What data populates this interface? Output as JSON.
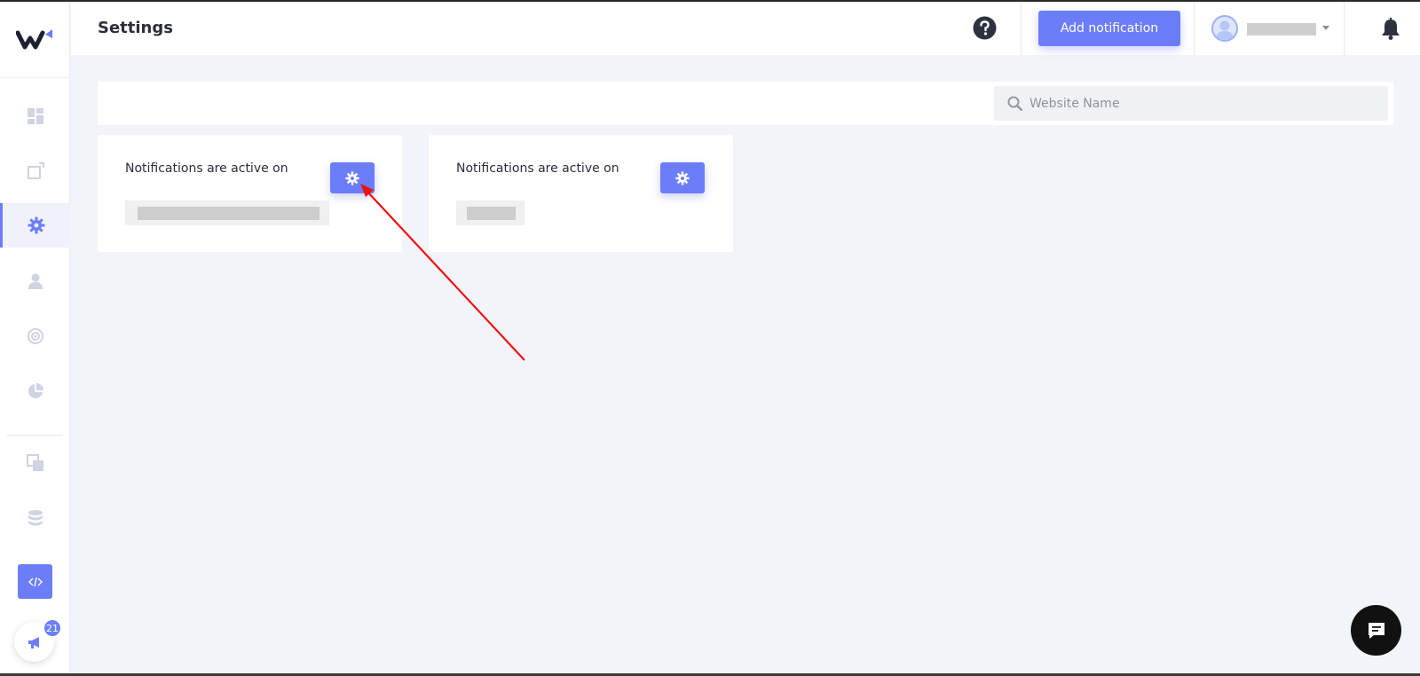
{
  "header": {
    "title": "Settings",
    "add_notification_label": "Add notification"
  },
  "search": {
    "placeholder": "Website Name"
  },
  "sidebar": {
    "items": [
      {
        "icon": "dashboard-icon"
      },
      {
        "icon": "new-window-icon"
      },
      {
        "icon": "settings-gear-icon",
        "active": true
      },
      {
        "icon": "user-icon"
      },
      {
        "icon": "target-icon"
      },
      {
        "icon": "pie-chart-icon"
      },
      {
        "icon": "layers-icon"
      },
      {
        "icon": "database-icon"
      }
    ],
    "announcement_badge": "21"
  },
  "cards": [
    {
      "label": "Notifications are active on"
    },
    {
      "label": "Notifications are active on"
    }
  ],
  "colors": {
    "accent": "#6c7dfa",
    "background": "#f3f4f9",
    "annotation_arrow": "#ee1111"
  }
}
